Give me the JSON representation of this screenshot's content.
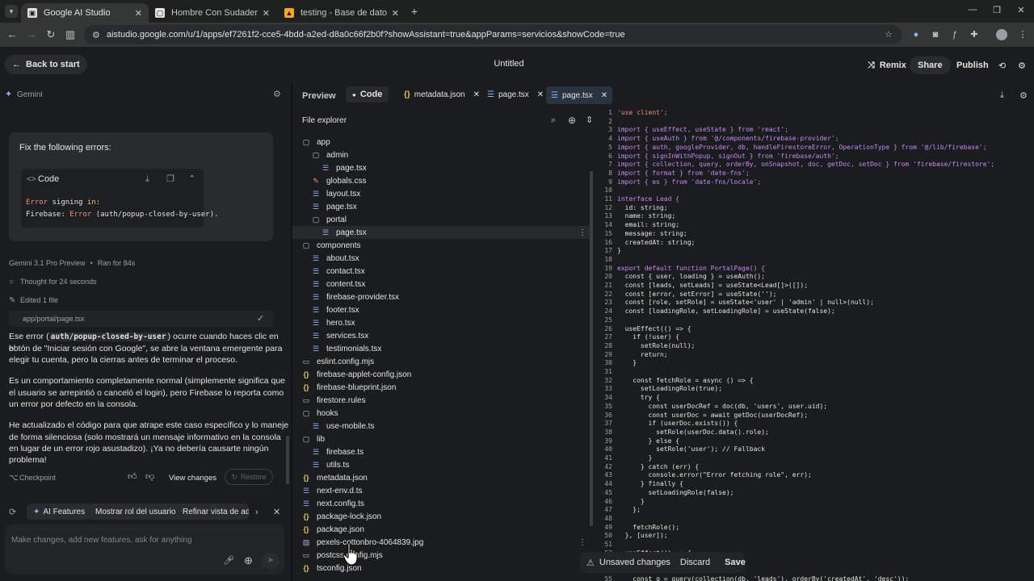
{
  "browser": {
    "tabs": [
      {
        "title": "Google AI Studio",
        "active": true
      },
      {
        "title": "Hombre Con Sudadera Negra (",
        "active": false
      },
      {
        "title": "testing - Base de datos - Datos",
        "active": false
      }
    ],
    "url": "aistudio.google.com/u/1/apps/ef7261f2-cce5-4bdd-a2ed-d8a0c66f2b0f?showAssistant=true&appParams=servicios&showCode=true"
  },
  "appbar": {
    "back_label": "Back to start",
    "title": "Untitled",
    "remix_label": "Remix",
    "share_label": "Share",
    "publish_label": "Publish"
  },
  "chat": {
    "header": "Gemini",
    "prompt": "Fix the following errors:",
    "code_label": "Code",
    "code_line1a": "Error",
    "code_line1b": " signing ",
    "code_line1c": "in:",
    "code_line2a": "Firebase: ",
    "code_line2b": "Error",
    "code_line2c": " (auth/popup-closed-by-user).",
    "model": "Gemini 3.1 Pro Preview",
    "ran_for": "Ran for 84s",
    "thought": "Thought for 24 seconds",
    "edited": "Edited 1 file",
    "file_path": "app/portal/page.tsx",
    "p1_a": "Ese error (",
    "p1_code": "auth/popup-closed-by-user",
    "p1_b": ") ocurre cuando haces clic en el",
    "p1_line2": "botón de \"Iniciar sesión con Google\", se abre la ventana emergente para",
    "p1_line3": "elegir tu cuenta, pero la cierras antes de terminar el proceso.",
    "p2_line1": "Es un comportamiento completamente normal (simplemente significa que",
    "p2_line2": "el usuario se arrepintió o canceló el login), pero Firebase lo reporta como",
    "p2_line3": "un error por defecto en la consola.",
    "p3_line1": "He actualizado el código para que atrape este caso específico y lo maneje",
    "p3_line2": "de forma silenciosa (solo mostrará un mensaje informativo en la consola",
    "p3_line3": "en lugar de un error rojo asustadizo). ¡Ya no debería causarte ningún",
    "p3_line4": "problema!",
    "checkpoint": "Checkpoint",
    "view_changes": "View changes",
    "restore": "Restore",
    "chips": [
      "AI Features",
      "Mostrar rol del usuario",
      "Refinar vista de adm"
    ],
    "composer_placeholder": "Make changes, add new features, ask for anything"
  },
  "editor_tabs": {
    "preview": "Preview",
    "code": "Code",
    "files": [
      "metadata.json",
      "page.tsx",
      "page.tsx"
    ]
  },
  "explorer": {
    "title": "File explorer",
    "rows": [
      {
        "name": "app",
        "type": "folder",
        "depth": 0
      },
      {
        "name": "admin",
        "type": "folder",
        "depth": 1
      },
      {
        "name": "page.tsx",
        "type": "tsx",
        "depth": 2
      },
      {
        "name": "globals.css",
        "type": "css",
        "depth": 1
      },
      {
        "name": "layout.tsx",
        "type": "tsx",
        "depth": 1
      },
      {
        "name": "page.tsx",
        "type": "tsx",
        "depth": 1
      },
      {
        "name": "portal",
        "type": "folder",
        "depth": 1
      },
      {
        "name": "page.tsx",
        "type": "tsx",
        "depth": 2,
        "selected": true
      },
      {
        "name": "components",
        "type": "folder",
        "depth": 0
      },
      {
        "name": "about.tsx",
        "type": "tsx",
        "depth": 1
      },
      {
        "name": "contact.tsx",
        "type": "tsx",
        "depth": 1
      },
      {
        "name": "content.tsx",
        "type": "tsx",
        "depth": 1
      },
      {
        "name": "firebase-provider.tsx",
        "type": "tsx",
        "depth": 1
      },
      {
        "name": "footer.tsx",
        "type": "tsx",
        "depth": 1
      },
      {
        "name": "hero.tsx",
        "type": "tsx",
        "depth": 1
      },
      {
        "name": "services.tsx",
        "type": "tsx",
        "depth": 1
      },
      {
        "name": "testimonials.tsx",
        "type": "tsx",
        "depth": 1
      },
      {
        "name": "eslint.config.mjs",
        "type": "file",
        "depth": 0
      },
      {
        "name": "firebase-applet-config.json",
        "type": "json",
        "depth": 0
      },
      {
        "name": "firebase-blueprint.json",
        "type": "json",
        "depth": 0
      },
      {
        "name": "firestore.rules",
        "type": "file",
        "depth": 0
      },
      {
        "name": "hooks",
        "type": "folder",
        "depth": 0
      },
      {
        "name": "use-mobile.ts",
        "type": "tsx",
        "depth": 1
      },
      {
        "name": "lib",
        "type": "folder",
        "depth": 0
      },
      {
        "name": "firebase.ts",
        "type": "tsx",
        "depth": 1
      },
      {
        "name": "utils.ts",
        "type": "tsx",
        "depth": 1
      },
      {
        "name": "metadata.json",
        "type": "json",
        "depth": 0
      },
      {
        "name": "next-env.d.ts",
        "type": "tsx",
        "depth": 0
      },
      {
        "name": "next.config.ts",
        "type": "tsx",
        "depth": 0
      },
      {
        "name": "package-lock.json",
        "type": "json",
        "depth": 0
      },
      {
        "name": "package.json",
        "type": "json",
        "depth": 0
      },
      {
        "name": "pexels-cottonbro-4064839.jpg",
        "type": "img",
        "depth": 0
      },
      {
        "name": "postcss.config.mjs",
        "type": "file",
        "depth": 0
      },
      {
        "name": "tsconfig.json",
        "type": "json",
        "depth": 0
      }
    ]
  },
  "code": {
    "lines": [
      {
        "n": "1",
        "t": "'use client';"
      },
      {
        "n": "2",
        "t": ""
      },
      {
        "n": "3",
        "t": "import { useEffect, useState } from 'react';"
      },
      {
        "n": "4",
        "t": "import { useAuth } from '@/components/firebase-provider';"
      },
      {
        "n": "5",
        "t": "import { auth, googleProvider, db, handleFirestoreError, OperationType } from '@/lib/firebase';"
      },
      {
        "n": "6",
        "t": "import { signInWithPopup, signOut } from 'firebase/auth';"
      },
      {
        "n": "7",
        "t": "import { collection, query, orderBy, onSnapshot, doc, getDoc, setDoc } from 'firebase/firestore';"
      },
      {
        "n": "8",
        "t": "import { format } from 'date-fns';"
      },
      {
        "n": "9",
        "t": "import { es } from 'date-fns/locale';"
      },
      {
        "n": "10",
        "t": ""
      },
      {
        "n": "11",
        "t": "interface Lead {"
      },
      {
        "n": "12",
        "t": "  id: string;"
      },
      {
        "n": "13",
        "t": "  name: string;"
      },
      {
        "n": "14",
        "t": "  email: string;"
      },
      {
        "n": "15",
        "t": "  message: string;"
      },
      {
        "n": "16",
        "t": "  createdAt: string;"
      },
      {
        "n": "17",
        "t": "}"
      },
      {
        "n": "18",
        "t": ""
      },
      {
        "n": "19",
        "t": "export default function PortalPage() {"
      },
      {
        "n": "20",
        "t": "  const { user, loading } = useAuth();"
      },
      {
        "n": "21",
        "t": "  const [leads, setLeads] = useState<Lead[]>([]);"
      },
      {
        "n": "22",
        "t": "  const [error, setError] = useState('');"
      },
      {
        "n": "23",
        "t": "  const [role, setRole] = useState<'user' | 'admin' | null>(null);"
      },
      {
        "n": "24",
        "t": "  const [loadingRole, setLoadingRole] = useState(false);"
      },
      {
        "n": "25",
        "t": ""
      },
      {
        "n": "26",
        "t": "  useEffect(() => {"
      },
      {
        "n": "27",
        "t": "    if (!user) {"
      },
      {
        "n": "28",
        "t": "      setRole(null);"
      },
      {
        "n": "29",
        "t": "      return;"
      },
      {
        "n": "30",
        "t": "    }"
      },
      {
        "n": "31",
        "t": ""
      },
      {
        "n": "32",
        "t": "    const fetchRole = async () => {"
      },
      {
        "n": "33",
        "t": "      setLoadingRole(true);"
      },
      {
        "n": "34",
        "t": "      try {"
      },
      {
        "n": "35",
        "t": "        const userDocRef = doc(db, 'users', user.uid);"
      },
      {
        "n": "36",
        "t": "        const userDoc = await getDoc(userDocRef);"
      },
      {
        "n": "37",
        "t": "        if (userDoc.exists()) {"
      },
      {
        "n": "38",
        "t": "          setRole(userDoc.data().role);"
      },
      {
        "n": "39",
        "t": "        } else {"
      },
      {
        "n": "40",
        "t": "          setRole('user'); // Fallback"
      },
      {
        "n": "41",
        "t": "        }"
      },
      {
        "n": "42",
        "t": "      } catch (err) {"
      },
      {
        "n": "43",
        "t": "        console.error(\"Error fetching role\", err);"
      },
      {
        "n": "44",
        "t": "      } finally {"
      },
      {
        "n": "45",
        "t": "        setLoadingRole(false);"
      },
      {
        "n": "46",
        "t": "      }"
      },
      {
        "n": "47",
        "t": "    };"
      },
      {
        "n": "48",
        "t": ""
      },
      {
        "n": "49",
        "t": "    fetchRole();"
      },
      {
        "n": "50",
        "t": "  }, [user]);"
      },
      {
        "n": "51",
        "t": ""
      },
      {
        "n": "52",
        "t": "  useEffect(() => {"
      },
      {
        "n": "53",
        "t": "    if (role !== 'admin') return;"
      },
      {
        "n": "54",
        "t": ""
      },
      {
        "n": "55",
        "t": "    const q = query(collection(db, 'leads'), orderBy('createdAt', 'desc'));"
      }
    ]
  },
  "unsaved": {
    "label": "Unsaved changes",
    "discard": "Discard",
    "save": "Save"
  },
  "colors": {
    "accent": "#8ab4f8",
    "error_text": "#f28b82",
    "keyword": "#c58af9",
    "string": "#f28b82",
    "success": "#81c995"
  }
}
